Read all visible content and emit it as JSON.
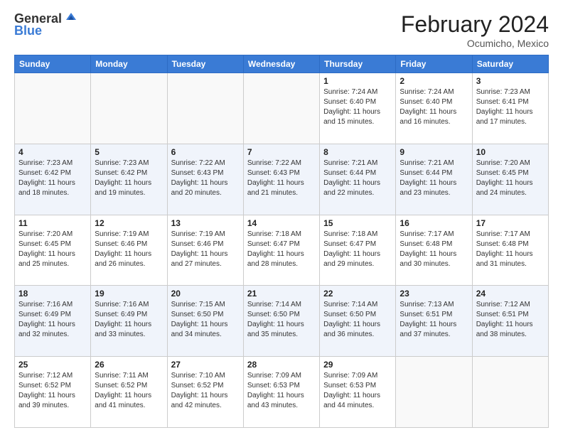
{
  "logo": {
    "text_general": "General",
    "text_blue": "Blue"
  },
  "header": {
    "month_year": "February 2024",
    "location": "Ocumicho, Mexico"
  },
  "weekdays": [
    "Sunday",
    "Monday",
    "Tuesday",
    "Wednesday",
    "Thursday",
    "Friday",
    "Saturday"
  ],
  "weeks": [
    [
      {
        "day": "",
        "sunrise": "",
        "sunset": "",
        "daylight": ""
      },
      {
        "day": "",
        "sunrise": "",
        "sunset": "",
        "daylight": ""
      },
      {
        "day": "",
        "sunrise": "",
        "sunset": "",
        "daylight": ""
      },
      {
        "day": "",
        "sunrise": "",
        "sunset": "",
        "daylight": ""
      },
      {
        "day": "1",
        "sunrise": "Sunrise: 7:24 AM",
        "sunset": "Sunset: 6:40 PM",
        "daylight": "Daylight: 11 hours and 15 minutes."
      },
      {
        "day": "2",
        "sunrise": "Sunrise: 7:24 AM",
        "sunset": "Sunset: 6:40 PM",
        "daylight": "Daylight: 11 hours and 16 minutes."
      },
      {
        "day": "3",
        "sunrise": "Sunrise: 7:23 AM",
        "sunset": "Sunset: 6:41 PM",
        "daylight": "Daylight: 11 hours and 17 minutes."
      }
    ],
    [
      {
        "day": "4",
        "sunrise": "Sunrise: 7:23 AM",
        "sunset": "Sunset: 6:42 PM",
        "daylight": "Daylight: 11 hours and 18 minutes."
      },
      {
        "day": "5",
        "sunrise": "Sunrise: 7:23 AM",
        "sunset": "Sunset: 6:42 PM",
        "daylight": "Daylight: 11 hours and 19 minutes."
      },
      {
        "day": "6",
        "sunrise": "Sunrise: 7:22 AM",
        "sunset": "Sunset: 6:43 PM",
        "daylight": "Daylight: 11 hours and 20 minutes."
      },
      {
        "day": "7",
        "sunrise": "Sunrise: 7:22 AM",
        "sunset": "Sunset: 6:43 PM",
        "daylight": "Daylight: 11 hours and 21 minutes."
      },
      {
        "day": "8",
        "sunrise": "Sunrise: 7:21 AM",
        "sunset": "Sunset: 6:44 PM",
        "daylight": "Daylight: 11 hours and 22 minutes."
      },
      {
        "day": "9",
        "sunrise": "Sunrise: 7:21 AM",
        "sunset": "Sunset: 6:44 PM",
        "daylight": "Daylight: 11 hours and 23 minutes."
      },
      {
        "day": "10",
        "sunrise": "Sunrise: 7:20 AM",
        "sunset": "Sunset: 6:45 PM",
        "daylight": "Daylight: 11 hours and 24 minutes."
      }
    ],
    [
      {
        "day": "11",
        "sunrise": "Sunrise: 7:20 AM",
        "sunset": "Sunset: 6:45 PM",
        "daylight": "Daylight: 11 hours and 25 minutes."
      },
      {
        "day": "12",
        "sunrise": "Sunrise: 7:19 AM",
        "sunset": "Sunset: 6:46 PM",
        "daylight": "Daylight: 11 hours and 26 minutes."
      },
      {
        "day": "13",
        "sunrise": "Sunrise: 7:19 AM",
        "sunset": "Sunset: 6:46 PM",
        "daylight": "Daylight: 11 hours and 27 minutes."
      },
      {
        "day": "14",
        "sunrise": "Sunrise: 7:18 AM",
        "sunset": "Sunset: 6:47 PM",
        "daylight": "Daylight: 11 hours and 28 minutes."
      },
      {
        "day": "15",
        "sunrise": "Sunrise: 7:18 AM",
        "sunset": "Sunset: 6:47 PM",
        "daylight": "Daylight: 11 hours and 29 minutes."
      },
      {
        "day": "16",
        "sunrise": "Sunrise: 7:17 AM",
        "sunset": "Sunset: 6:48 PM",
        "daylight": "Daylight: 11 hours and 30 minutes."
      },
      {
        "day": "17",
        "sunrise": "Sunrise: 7:17 AM",
        "sunset": "Sunset: 6:48 PM",
        "daylight": "Daylight: 11 hours and 31 minutes."
      }
    ],
    [
      {
        "day": "18",
        "sunrise": "Sunrise: 7:16 AM",
        "sunset": "Sunset: 6:49 PM",
        "daylight": "Daylight: 11 hours and 32 minutes."
      },
      {
        "day": "19",
        "sunrise": "Sunrise: 7:16 AM",
        "sunset": "Sunset: 6:49 PM",
        "daylight": "Daylight: 11 hours and 33 minutes."
      },
      {
        "day": "20",
        "sunrise": "Sunrise: 7:15 AM",
        "sunset": "Sunset: 6:50 PM",
        "daylight": "Daylight: 11 hours and 34 minutes."
      },
      {
        "day": "21",
        "sunrise": "Sunrise: 7:14 AM",
        "sunset": "Sunset: 6:50 PM",
        "daylight": "Daylight: 11 hours and 35 minutes."
      },
      {
        "day": "22",
        "sunrise": "Sunrise: 7:14 AM",
        "sunset": "Sunset: 6:50 PM",
        "daylight": "Daylight: 11 hours and 36 minutes."
      },
      {
        "day": "23",
        "sunrise": "Sunrise: 7:13 AM",
        "sunset": "Sunset: 6:51 PM",
        "daylight": "Daylight: 11 hours and 37 minutes."
      },
      {
        "day": "24",
        "sunrise": "Sunrise: 7:12 AM",
        "sunset": "Sunset: 6:51 PM",
        "daylight": "Daylight: 11 hours and 38 minutes."
      }
    ],
    [
      {
        "day": "25",
        "sunrise": "Sunrise: 7:12 AM",
        "sunset": "Sunset: 6:52 PM",
        "daylight": "Daylight: 11 hours and 39 minutes."
      },
      {
        "day": "26",
        "sunrise": "Sunrise: 7:11 AM",
        "sunset": "Sunset: 6:52 PM",
        "daylight": "Daylight: 11 hours and 41 minutes."
      },
      {
        "day": "27",
        "sunrise": "Sunrise: 7:10 AM",
        "sunset": "Sunset: 6:52 PM",
        "daylight": "Daylight: 11 hours and 42 minutes."
      },
      {
        "day": "28",
        "sunrise": "Sunrise: 7:09 AM",
        "sunset": "Sunset: 6:53 PM",
        "daylight": "Daylight: 11 hours and 43 minutes."
      },
      {
        "day": "29",
        "sunrise": "Sunrise: 7:09 AM",
        "sunset": "Sunset: 6:53 PM",
        "daylight": "Daylight: 11 hours and 44 minutes."
      },
      {
        "day": "",
        "sunrise": "",
        "sunset": "",
        "daylight": ""
      },
      {
        "day": "",
        "sunrise": "",
        "sunset": "",
        "daylight": ""
      }
    ]
  ]
}
